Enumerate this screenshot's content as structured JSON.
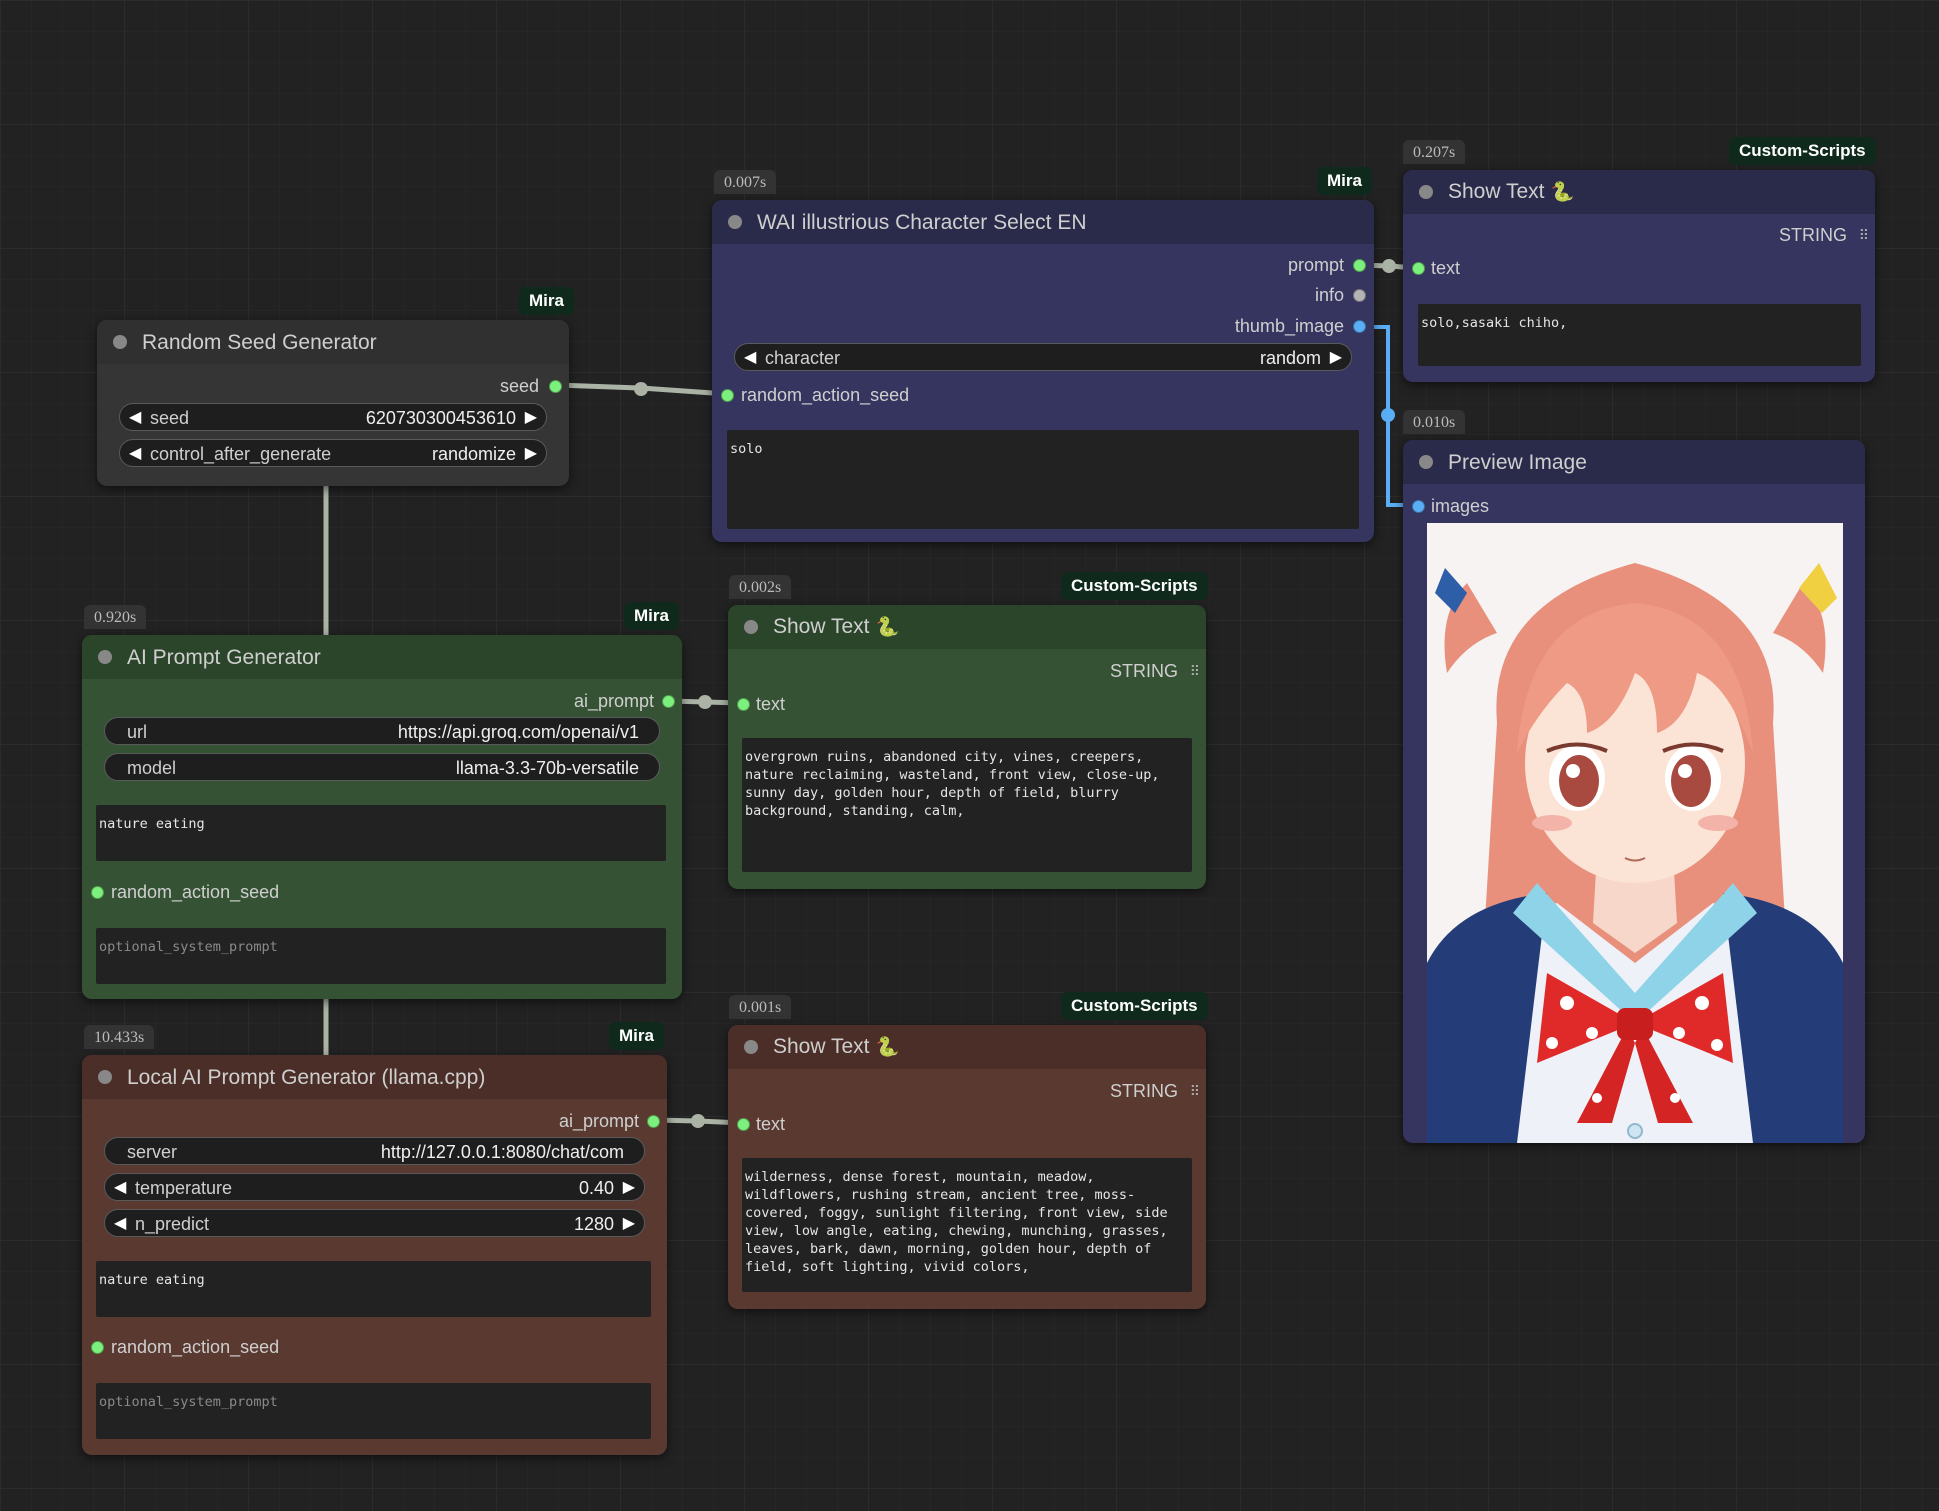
{
  "nodes": {
    "random_seed": {
      "title": "Random Seed Generator",
      "tag": "Mira",
      "output": "seed",
      "seed_label": "seed",
      "seed_value": "620730300453610",
      "control_label": "control_after_generate",
      "control_value": "randomize"
    },
    "wai": {
      "time": "0.007s",
      "tag": "Mira",
      "title": "WAI illustrious Character Select EN",
      "out_prompt": "prompt",
      "out_info": "info",
      "out_thumb": "thumb_image",
      "character_label": "character",
      "character_value": "random",
      "input_seed": "random_action_seed",
      "text": "solo"
    },
    "show_text_top": {
      "time": "0.207s",
      "tag": "Custom-Scripts",
      "title": "Show Text",
      "type": "STRING",
      "input": "text",
      "text": "solo,sasaki chiho,"
    },
    "preview": {
      "time": "0.010s",
      "title": "Preview Image",
      "input": "images"
    },
    "ai_prompt": {
      "time": "0.920s",
      "tag": "Mira",
      "title": "AI Prompt Generator",
      "output": "ai_prompt",
      "url_label": "url",
      "url_value": "https://api.groq.com/openai/v1",
      "model_label": "model",
      "model_value": "llama-3.3-70b-versatile",
      "text": "nature eating",
      "input_seed": "random_action_seed",
      "system_placeholder": "optional_system_prompt"
    },
    "show_text_mid": {
      "time": "0.002s",
      "tag": "Custom-Scripts",
      "title": "Show Text",
      "type": "STRING",
      "input": "text",
      "text": "overgrown ruins, abandoned city, vines, creepers, nature reclaiming, wasteland, front view, close-up, sunny day, golden hour, depth of field, blurry background, standing, calm,"
    },
    "local_ai": {
      "time": "10.433s",
      "tag": "Mira",
      "title": "Local AI Prompt Generator (llama.cpp)",
      "output": "ai_prompt",
      "server_label": "server",
      "server_value": "http://127.0.0.1:8080/chat/com",
      "temp_label": "temperature",
      "temp_value": "0.40",
      "npred_label": "n_predict",
      "npred_value": "1280",
      "text": "nature eating",
      "input_seed": "random_action_seed",
      "system_placeholder": "optional_system_prompt"
    },
    "show_text_bot": {
      "time": "0.001s",
      "tag": "Custom-Scripts",
      "title": "Show Text",
      "type": "STRING",
      "input": "text",
      "text": "wilderness, dense forest, mountain, meadow, wildflowers, rushing stream, ancient tree, moss-covered, foggy, sunlight filtering, front view, side view, low angle, eating, chewing, munching, grasses, leaves, bark, dawn, morning, golden hour, depth of field, soft lighting, vivid colors,"
    }
  },
  "colors": {
    "canvas": "#222222",
    "wai_node": "#353560",
    "ai_node": "#355235",
    "local_node": "#593930",
    "neutral_node": "#353535",
    "wire": "#aab3a5",
    "image_wire": "#5aaef5"
  },
  "icons": {
    "snake": "python-snake-icon",
    "grid": "grid-dots-icon",
    "left": "arrow-left-icon",
    "right": "arrow-right-icon"
  }
}
